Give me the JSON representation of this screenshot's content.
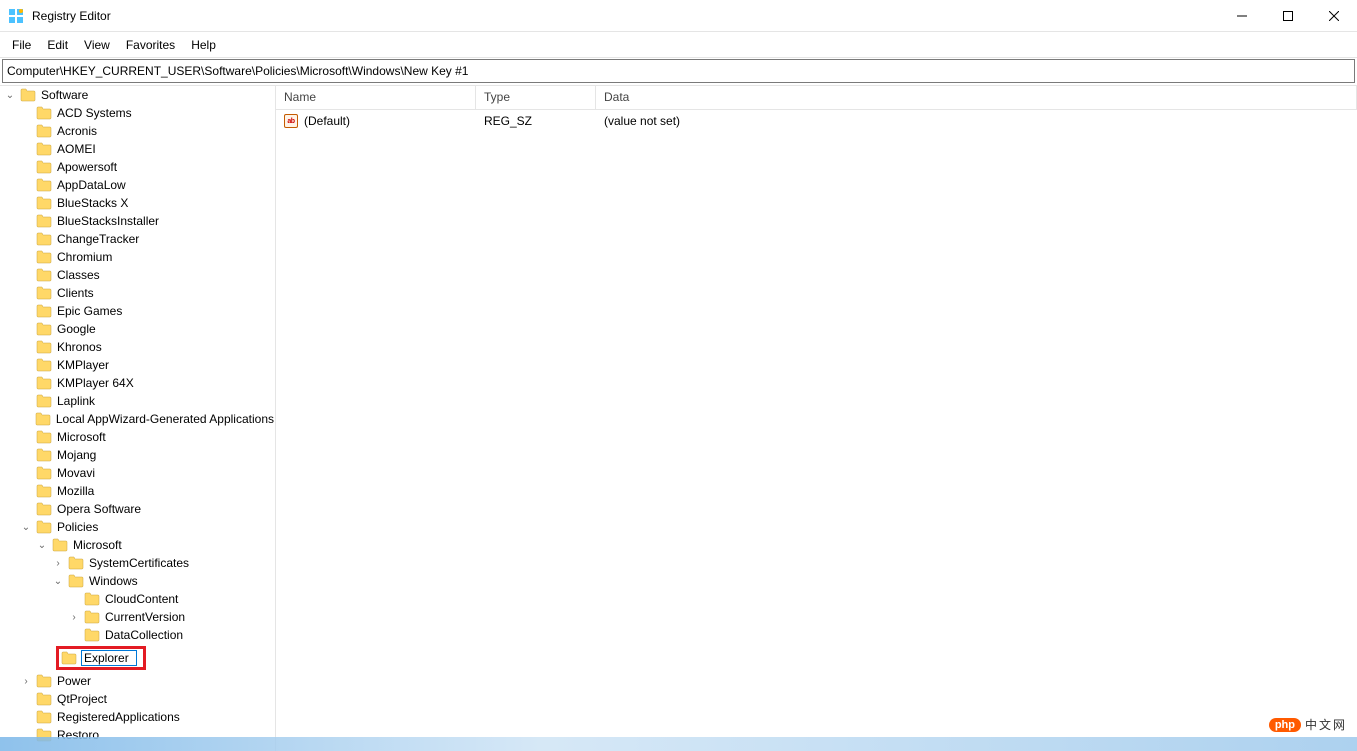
{
  "window": {
    "title": "Registry Editor"
  },
  "menu": {
    "items": [
      "File",
      "Edit",
      "View",
      "Favorites",
      "Help"
    ]
  },
  "address": {
    "path": "Computer\\HKEY_CURRENT_USER\\Software\\Policies\\Microsoft\\Windows\\New Key #1"
  },
  "tree": {
    "root": "Software",
    "children": [
      {
        "label": "ACD Systems"
      },
      {
        "label": "Acronis"
      },
      {
        "label": "AOMEI"
      },
      {
        "label": "Apowersoft"
      },
      {
        "label": "AppDataLow"
      },
      {
        "label": "BlueStacks X"
      },
      {
        "label": "BlueStacksInstaller"
      },
      {
        "label": "ChangeTracker"
      },
      {
        "label": "Chromium"
      },
      {
        "label": "Classes"
      },
      {
        "label": "Clients"
      },
      {
        "label": "Epic Games"
      },
      {
        "label": "Google"
      },
      {
        "label": "Khronos"
      },
      {
        "label": "KMPlayer"
      },
      {
        "label": "KMPlayer 64X"
      },
      {
        "label": "Laplink"
      },
      {
        "label": "Local AppWizard-Generated Applications"
      },
      {
        "label": "Microsoft"
      },
      {
        "label": "Mojang"
      },
      {
        "label": "Movavi"
      },
      {
        "label": "Mozilla"
      },
      {
        "label": "Opera Software"
      }
    ],
    "policies": {
      "label": "Policies",
      "microsoft": {
        "label": "Microsoft",
        "system_certificates": "SystemCertificates",
        "windows": {
          "label": "Windows",
          "children": [
            "CloudContent",
            "CurrentVersion",
            "DataCollection"
          ],
          "editing": "Explorer"
        }
      }
    },
    "after_policies": [
      {
        "label": "Power",
        "has_children": true
      },
      {
        "label": "QtProject"
      },
      {
        "label": "RegisteredApplications"
      },
      {
        "label": "Restoro"
      }
    ]
  },
  "values": {
    "columns": {
      "name": "Name",
      "type": "Type",
      "data": "Data"
    },
    "rows": [
      {
        "name": "(Default)",
        "type": "REG_SZ",
        "data": "(value not set)",
        "icon": "sz"
      }
    ]
  },
  "icons": {
    "sz_text": "ab"
  },
  "watermark": {
    "pill": "php",
    "text": "中文网"
  }
}
